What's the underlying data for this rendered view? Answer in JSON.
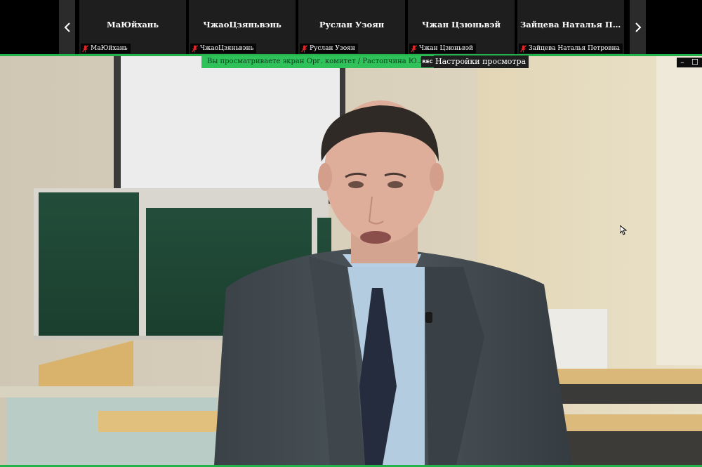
{
  "participants": [
    {
      "name": "МаЮйхань",
      "label": "МаЮйхань"
    },
    {
      "name": "ЧжаоЦзяньвэнь",
      "label": "ЧжаоЦзяньвэнь"
    },
    {
      "name": "Руслан Узоян",
      "label": "Руслан Узоян"
    },
    {
      "name": "Чжан Цзюньвэй",
      "label": "Чжан Цзюньвэй"
    },
    {
      "name": "Зайцева Наталья Петров...",
      "label": "Зайцева Наталья Петровна"
    }
  ],
  "banner": {
    "viewing_text": "Вы просматриваете экран Орг. комитет / Растопчина Ю.Л.",
    "rec": "REC",
    "view_options": "Настройки просмотра"
  },
  "window_controls": {
    "minimize": "–",
    "more": "☐"
  },
  "icons": {
    "prev": "chevron-left-icon",
    "next": "chevron-right-icon",
    "mic_off": "mic-off-icon",
    "mic": "mic-icon"
  },
  "colors": {
    "accent_green": "#23b34a",
    "banner_green": "#2fc25b",
    "mic_muted": "#e02828"
  }
}
